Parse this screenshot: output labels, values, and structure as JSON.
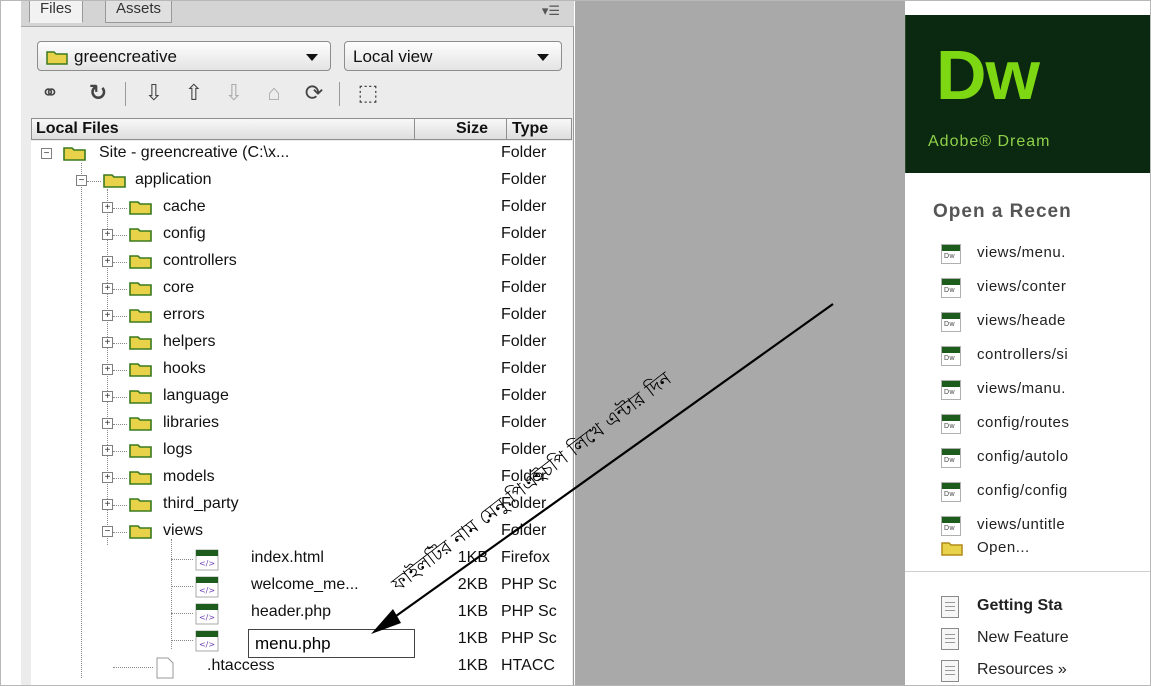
{
  "panel": {
    "tabs": [
      "Files",
      "Assets"
    ],
    "site_name": "greencreative",
    "view": "Local view",
    "columns": {
      "local": "Local Files",
      "size": "Size",
      "type": "Type"
    }
  },
  "tree": [
    {
      "name": "Site - greencreative (C:\\x...",
      "size": "",
      "type": "Folder"
    },
    {
      "name": "application",
      "size": "",
      "type": "Folder"
    },
    {
      "name": "cache",
      "size": "",
      "type": "Folder"
    },
    {
      "name": "config",
      "size": "",
      "type": "Folder"
    },
    {
      "name": "controllers",
      "size": "",
      "type": "Folder"
    },
    {
      "name": "core",
      "size": "",
      "type": "Folder"
    },
    {
      "name": "errors",
      "size": "",
      "type": "Folder"
    },
    {
      "name": "helpers",
      "size": "",
      "type": "Folder"
    },
    {
      "name": "hooks",
      "size": "",
      "type": "Folder"
    },
    {
      "name": "language",
      "size": "",
      "type": "Folder"
    },
    {
      "name": "libraries",
      "size": "",
      "type": "Folder"
    },
    {
      "name": "logs",
      "size": "",
      "type": "Folder"
    },
    {
      "name": "models",
      "size": "",
      "type": "Folder"
    },
    {
      "name": "third_party",
      "size": "",
      "type": "Folder"
    },
    {
      "name": "views",
      "size": "",
      "type": "Folder"
    },
    {
      "name": "index.html",
      "size": "1KB",
      "type": "Firefox"
    },
    {
      "name": "welcome_me...",
      "size": "2KB",
      "type": "PHP Sc"
    },
    {
      "name": "header.php",
      "size": "1KB",
      "type": "PHP Sc"
    },
    {
      "name": "",
      "size": "1KB",
      "type": "PHP Sc"
    },
    {
      "name": ".htaccess",
      "size": "1KB",
      "type": "HTACC"
    }
  ],
  "rename_value": "menu.php",
  "annotation": "ফাইলটির নাম মেনু.পিএইচপি লিখে এন্টার দিন",
  "welcome": {
    "logo": "Dw",
    "product": "Adobe® Dream",
    "recent_title": "Open a Recen",
    "recent": [
      "views/menu.",
      "views/conter",
      "views/heade",
      "controllers/si",
      "views/manu.",
      "config/routes",
      "config/autolo",
      "config/config",
      "views/untitle"
    ],
    "open": "Open...",
    "resources": [
      "Getting Sta",
      "New Feature",
      "Resources »"
    ]
  },
  "colors": {
    "dw_green": "#7dd813",
    "banner_bg": "#0b2810",
    "gray_area": "#a9a9a9",
    "folder_yellow": "#e8d24a",
    "folder_stroke": "#3a7a1e"
  }
}
